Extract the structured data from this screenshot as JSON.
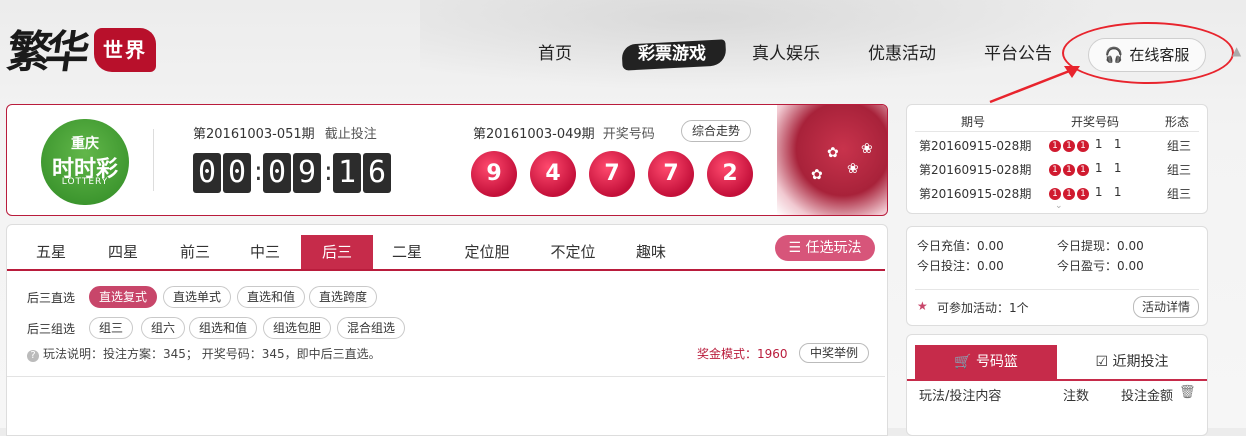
{
  "brand": {
    "name_part1": "繁华",
    "name_part2": "世界"
  },
  "nav": {
    "items": [
      "首页",
      "彩票游戏",
      "真人娱乐",
      "优惠活动",
      "平台公告"
    ],
    "service_label": "在线客服"
  },
  "lottery": {
    "badge_top": "重庆",
    "badge_main": "时时彩",
    "badge_sub": "LOTTERY",
    "current_issue": "第20161003-051期",
    "current_status": "截止投注",
    "countdown": [
      "0",
      "0",
      "0",
      "9",
      "1",
      "6"
    ],
    "last_issue": "第20161003-049期",
    "last_label": "开奖号码",
    "trend_label": "综合走势",
    "numbers": [
      "9",
      "4",
      "7",
      "7",
      "2"
    ]
  },
  "tabs": [
    "五星",
    "四星",
    "前三",
    "中三",
    "后三",
    "二星",
    "定位胆",
    "不定位",
    "趣味"
  ],
  "active_tab": "后三",
  "optional_label": "任选玩法",
  "rows": [
    {
      "label": "后三直选",
      "chips": [
        "直选复式",
        "直选单式",
        "直选和值",
        "直选跨度"
      ],
      "active": "直选复式"
    },
    {
      "label": "后三组选",
      "chips": [
        "组三",
        "组六",
        "组选和值",
        "组选包胆",
        "混合组选"
      ],
      "active": ""
    }
  ],
  "info_text": "玩法说明：投注方案：345； 开奖号码：345，即中后三直选。",
  "prize_text": "奖金模式：1960",
  "example_label": "中奖举例",
  "history": {
    "headers": [
      "期号",
      "开奖号码",
      "形态"
    ],
    "rows": [
      {
        "issue": "第20160915-028期",
        "balls": [
          "1",
          "1",
          "1"
        ],
        "plain": [
          "1",
          "1"
        ],
        "shape": "组三"
      },
      {
        "issue": "第20160915-028期",
        "balls": [
          "1",
          "1",
          "1"
        ],
        "plain": [
          "1",
          "1"
        ],
        "shape": "组三"
      },
      {
        "issue": "第20160915-028期",
        "balls": [
          "1",
          "1",
          "1"
        ],
        "plain": [
          "1",
          "1"
        ],
        "shape": "组三"
      }
    ]
  },
  "account": {
    "recharge": "今日充值：0.00",
    "withdraw": "今日提现：0.00",
    "bet": "今日投注：0.00",
    "profit": "今日盈亏：0.00",
    "activities": "可参加活动：1个",
    "activity_btn": "活动详情"
  },
  "cart": {
    "tab_active": "号码篮",
    "tab_other": "近期投注",
    "col1": "玩法/投注内容",
    "col2": "注数",
    "col3": "投注金额"
  }
}
